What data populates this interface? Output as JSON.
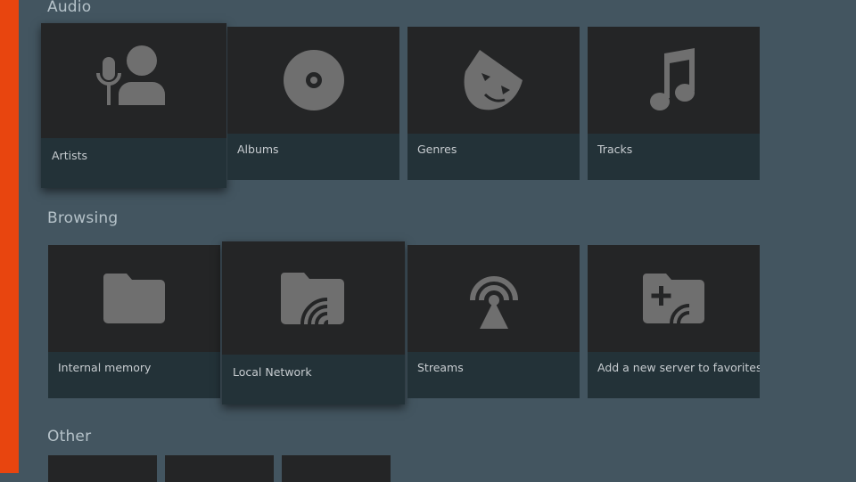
{
  "colors": {
    "background": "#435560",
    "accent": "#e8450f",
    "card": "#242526",
    "card_label_bg": "#233238",
    "icon": "#6f6f6f"
  },
  "sections": {
    "audio": {
      "title": "Audio",
      "items": [
        {
          "label": "Artists",
          "icon": "artist-mic-person-icon",
          "focused": true
        },
        {
          "label": "Albums",
          "icon": "album-disc-icon"
        },
        {
          "label": "Genres",
          "icon": "genre-mask-icon"
        },
        {
          "label": "Tracks",
          "icon": "music-note-icon"
        }
      ]
    },
    "browsing": {
      "title": "Browsing",
      "items": [
        {
          "label": "Internal memory",
          "icon": "folder-icon"
        },
        {
          "label": "Local Network",
          "icon": "network-folder-icon",
          "focused": true
        },
        {
          "label": "Streams",
          "icon": "antenna-stream-icon"
        },
        {
          "label": "Add a new server to favorites",
          "icon": "add-server-folder-icon"
        }
      ]
    },
    "other": {
      "title": "Other"
    }
  }
}
